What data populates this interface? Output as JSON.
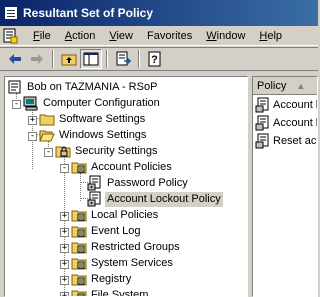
{
  "window": {
    "title": "Resultant Set of Policy"
  },
  "menu": [
    {
      "label": "File",
      "accel": "F",
      "rest": "ile"
    },
    {
      "label": "Action",
      "accel": "A",
      "rest": "ction"
    },
    {
      "label": "View",
      "accel": "V",
      "rest": "iew"
    },
    {
      "label": "Favorites",
      "accel": "",
      "rest": "Favorites"
    },
    {
      "label": "Window",
      "accel": "W",
      "rest": "indow"
    },
    {
      "label": "Help",
      "accel": "H",
      "rest": "elp"
    }
  ],
  "tree": {
    "items": [
      {
        "label": "Bob on TAZMANIA - RSoP",
        "icon": "rsop-icon"
      },
      {
        "label": "Computer Configuration",
        "icon": "computer-icon",
        "expander": "-"
      },
      {
        "label": "Software Settings",
        "icon": "folder-icon",
        "expander": "+"
      },
      {
        "label": "Windows Settings",
        "icon": "folder-icon",
        "expander": "-"
      },
      {
        "label": "Security Settings",
        "icon": "security-icon",
        "expander": "-"
      },
      {
        "label": "Account Policies",
        "icon": "policy-folder-icon",
        "expander": "-"
      },
      {
        "label": "Password Policy",
        "icon": "policy-icon"
      },
      {
        "label": "Account Lockout Policy",
        "icon": "policy-icon",
        "selected": true
      },
      {
        "label": "Local Policies",
        "icon": "policy-folder-icon",
        "expander": "+"
      },
      {
        "label": "Event Log",
        "icon": "policy-folder-icon",
        "expander": "+"
      },
      {
        "label": "Restricted Groups",
        "icon": "policy-folder-icon",
        "expander": "+"
      },
      {
        "label": "System Services",
        "icon": "policy-folder-icon",
        "expander": "+"
      },
      {
        "label": "Registry",
        "icon": "policy-folder-icon",
        "expander": "+"
      },
      {
        "label": "File System",
        "icon": "policy-folder-icon",
        "expander": "+"
      }
    ]
  },
  "details": {
    "column_header": "Policy",
    "rows": [
      {
        "label": "Account lo"
      },
      {
        "label": "Account lo"
      },
      {
        "label": "Reset acc"
      }
    ]
  }
}
